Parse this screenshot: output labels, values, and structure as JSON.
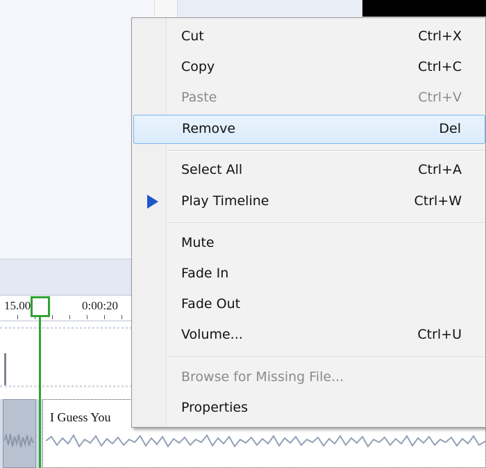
{
  "timeline": {
    "ruler_labels": [
      "15.00",
      "0:00:20"
    ],
    "clip_title": "I Guess You"
  },
  "context_menu": {
    "items": [
      {
        "label": "Cut",
        "shortcut": "Ctrl+X",
        "state": "enabled"
      },
      {
        "label": "Copy",
        "shortcut": "Ctrl+C",
        "state": "enabled"
      },
      {
        "label": "Paste",
        "shortcut": "Ctrl+V",
        "state": "disabled"
      },
      {
        "label": "Remove",
        "shortcut": "Del",
        "state": "highlighted"
      },
      {
        "label": "Select All",
        "shortcut": "Ctrl+A",
        "state": "enabled"
      },
      {
        "label": "Play Timeline",
        "shortcut": "Ctrl+W",
        "state": "enabled",
        "icon": "play-icon"
      },
      {
        "label": "Mute",
        "shortcut": "",
        "state": "enabled"
      },
      {
        "label": "Fade In",
        "shortcut": "",
        "state": "enabled"
      },
      {
        "label": "Fade Out",
        "shortcut": "",
        "state": "enabled"
      },
      {
        "label": "Volume...",
        "shortcut": "Ctrl+U",
        "state": "enabled"
      },
      {
        "label": "Browse for Missing File...",
        "shortcut": "",
        "state": "disabled"
      },
      {
        "label": "Properties",
        "shortcut": "",
        "state": "enabled"
      }
    ]
  },
  "colors": {
    "highlight_border": "#7eb4ea",
    "playhead": "#2fa234",
    "play_icon": "#1b57c9",
    "disabled_text": "#8a8a8a"
  }
}
